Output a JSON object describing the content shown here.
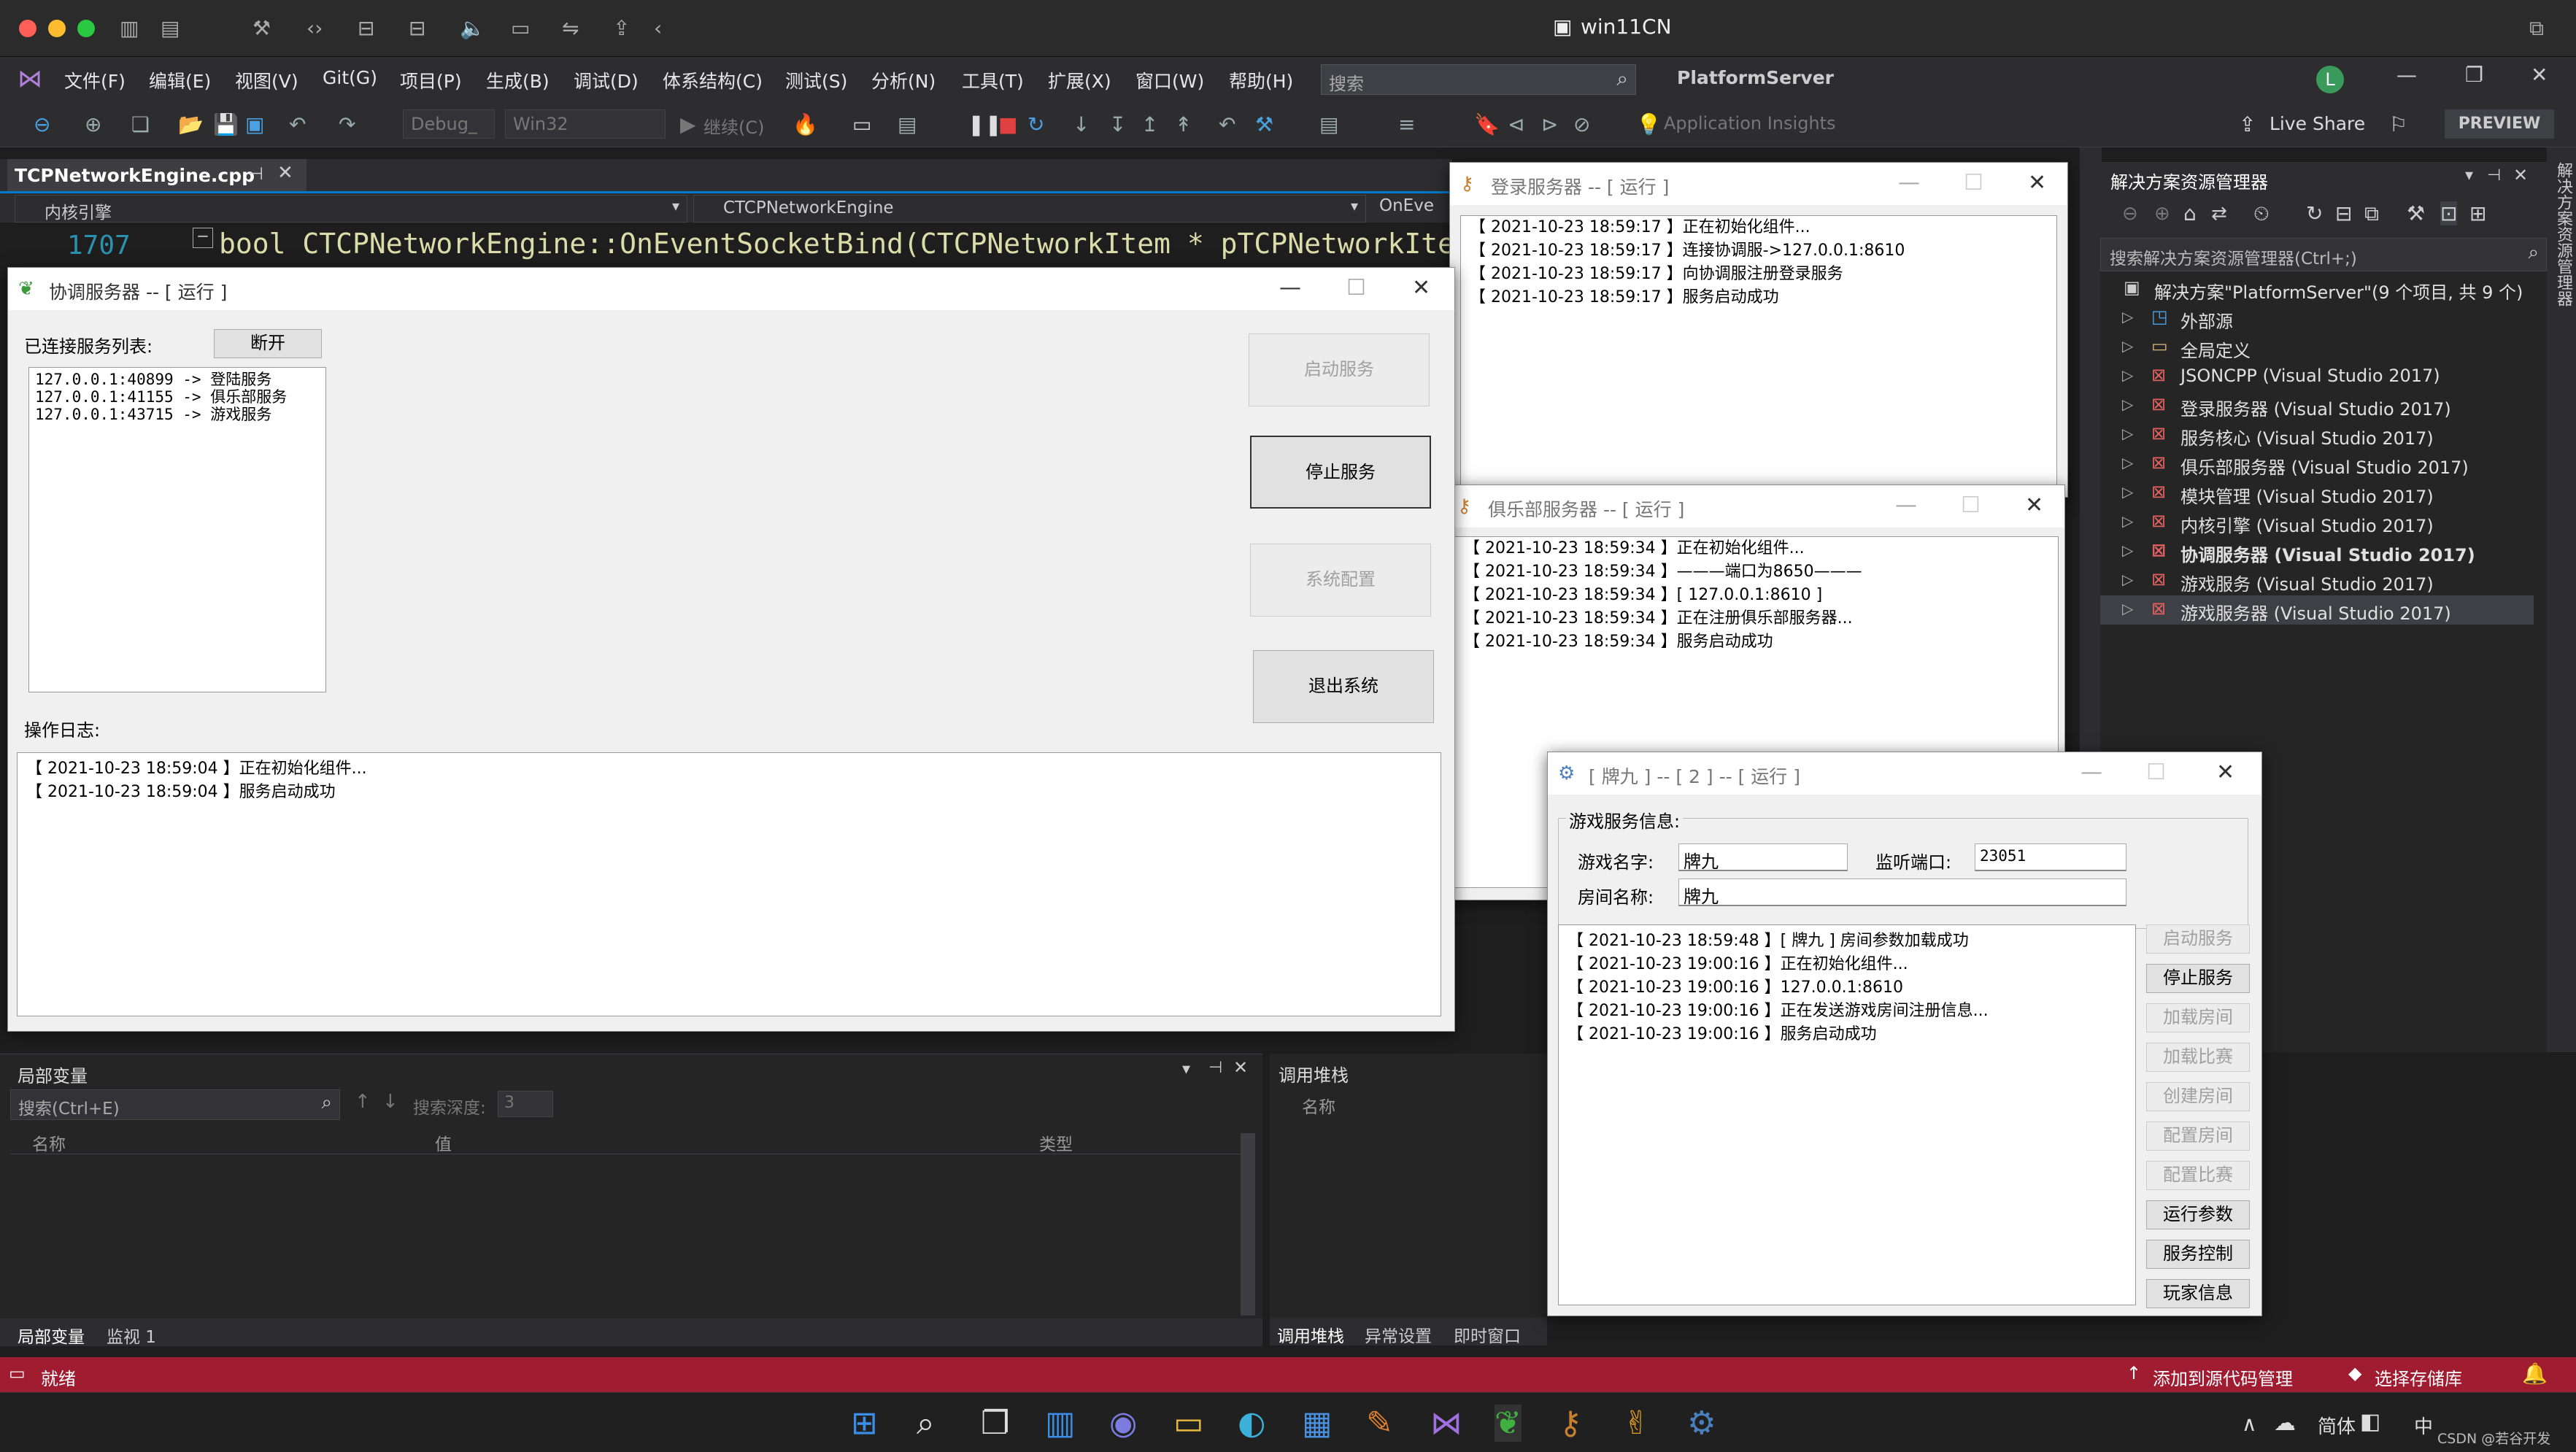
{
  "mac": {
    "title": "win11CN"
  },
  "vs": {
    "menu": [
      "文件(F)",
      "编辑(E)",
      "视图(V)",
      "Git(G)",
      "项目(P)",
      "生成(B)",
      "调试(D)",
      "体系结构(C)",
      "测试(S)",
      "分析(N)",
      "工具(T)",
      "扩展(X)",
      "窗口(W)",
      "帮助(H)"
    ],
    "search_placeholder": "搜索",
    "solution_name": "PlatformServer",
    "user_initial": "L",
    "toolbar": {
      "config": "Debug_",
      "platform": "Win32",
      "continue": "继续(C)",
      "app_insights": "Application Insights",
      "live_share": "Live Share",
      "preview": "PREVIEW"
    },
    "editor_tab": "TCPNetworkEngine.cpp",
    "nav_left": "内核引擎",
    "nav_mid": "CTCPNetworkEngine",
    "nav_right": "OnEve",
    "code_line_no": "1707",
    "code_line": "bool CTCPNetworkEngine::OnEventSocketBind(CTCPNetworkItem * pTCPNetworkItem)"
  },
  "coord_win": {
    "title": "协调服务器 -- [ 运行 ]",
    "connected_label": "已连接服务列表:",
    "disconnect": "断开",
    "connections": [
      "127.0.0.1:40899 -> 登陆服务",
      "127.0.0.1:41155 -> 俱乐部服务",
      "127.0.0.1:43715 -> 游戏服务"
    ],
    "buttons": {
      "start": "启动服务",
      "stop": "停止服务",
      "config": "系统配置",
      "exit": "退出系统"
    },
    "log_label": "操作日志:",
    "log": [
      {
        "t": "【 2021-10-23 18:59:04 】",
        "m": "正在初始化组件..."
      },
      {
        "t": "【 2021-10-23 18:59:04 】",
        "m": "服务启动成功"
      }
    ]
  },
  "login_win": {
    "title": "登录服务器 -- [ 运行 ]",
    "log": [
      {
        "t": "【 2021-10-23 18:59:17 】",
        "m": "正在初始化组件..."
      },
      {
        "t": "【 2021-10-23 18:59:17 】",
        "m": "连接协调服->127.0.0.1:8610"
      },
      {
        "t": "【 2021-10-23 18:59:17 】",
        "m": "向协调服注册登录服务"
      },
      {
        "t": "【 2021-10-23 18:59:17 】",
        "m": "服务启动成功"
      }
    ]
  },
  "club_win": {
    "title": "俱乐部服务器 -- [ 运行 ]",
    "log": [
      {
        "t": "【 2021-10-23 18:59:34 】",
        "m": "正在初始化组件..."
      },
      {
        "t": "【 2021-10-23 18:59:34 】",
        "m": "———端口为8650———"
      },
      {
        "t": "【 2021-10-23 18:59:34 】",
        "m": "[ 127.0.0.1:8610 ]"
      },
      {
        "t": "【 2021-10-23 18:59:34 】",
        "m": "正在注册俱乐部服务器..."
      },
      {
        "t": "【 2021-10-23 18:59:34 】",
        "m": "服务启动成功"
      }
    ]
  },
  "game_win": {
    "title": "[ 牌九 ] -- [ 2 ] -- [ 运行 ]",
    "group_label": "游戏服务信息:",
    "game_name_label": "游戏名字:",
    "game_name": "牌九",
    "port_label": "监听端口:",
    "port": "23051",
    "room_label": "房间名称:",
    "room_name": "牌九",
    "log": [
      {
        "t": "【 2021-10-23 18:59:48 】",
        "m": "[ 牌九 ] 房间参数加载成功"
      },
      {
        "t": "【 2021-10-23 19:00:16 】",
        "m": "正在初始化组件..."
      },
      {
        "t": "【 2021-10-23 19:00:16 】",
        "m": "127.0.0.1:8610"
      },
      {
        "t": "【 2021-10-23 19:00:16 】",
        "m": "正在发送游戏房间注册信息..."
      },
      {
        "t": "【 2021-10-23 19:00:16 】",
        "m": "服务启动成功"
      }
    ],
    "buttons": [
      "启动服务",
      "停止服务",
      "加载房间",
      "加载比赛",
      "创建房间",
      "配置房间",
      "配置比赛",
      "运行参数",
      "服务控制",
      "玩家信息"
    ]
  },
  "solution": {
    "title": "解决方案资源管理器",
    "search": "搜索解决方案资源管理器(Ctrl+;)",
    "root": "解决方案\"PlatformServer\"(9 个项目, 共 9 个)",
    "items": [
      "外部源",
      "全局定义",
      "JSONCPP (Visual Studio 2017)",
      "登录服务器 (Visual Studio 2017)",
      "服务核心 (Visual Studio 2017)",
      "俱乐部服务器 (Visual Studio 2017)",
      "模块管理 (Visual Studio 2017)",
      "内核引擎 (Visual Studio 2017)",
      "协调服务器 (Visual Studio 2017)",
      "游戏服务 (Visual Studio 2017)",
      "游戏服务器 (Visual Studio 2017)"
    ],
    "side_tab": "解决方案资源管理器"
  },
  "locals": {
    "title": "局部变量",
    "search": "搜索(Ctrl+E)",
    "depth_label": "搜索深度:",
    "depth": "3",
    "cols": [
      "名称",
      "值",
      "类型"
    ],
    "tabs": [
      "局部变量",
      "监视 1"
    ]
  },
  "callstack": {
    "title": "调用堆栈",
    "col": "名称",
    "tabs": [
      "调用堆栈",
      "异常设置",
      "即时窗口"
    ]
  },
  "status": {
    "ready": "就绪",
    "source_control": "添加到源代码管理",
    "repo": "选择存储库"
  },
  "taskbar": {
    "ime": "中",
    "lang": "简体",
    "watermark": "CSDN @若谷开发"
  }
}
